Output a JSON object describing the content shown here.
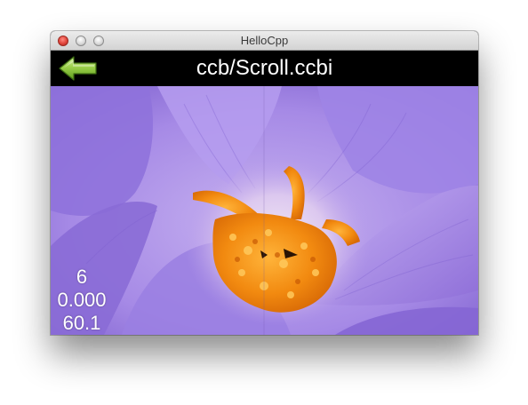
{
  "window": {
    "title": "HelloCpp"
  },
  "header": {
    "title": "ccb/Scroll.ccbi"
  },
  "icons": {
    "back": "back-arrow-icon",
    "close": "close-icon",
    "minimize": "minimize-icon",
    "zoom": "zoom-icon"
  },
  "stats": {
    "draw_calls": "6",
    "seconds_per_frame": "0.000",
    "fps": "60.1"
  },
  "colors": {
    "petal": "#a98be8",
    "petal_dark": "#7f5fd0",
    "stamen": "#f08a12",
    "header_background": "#000000",
    "back_arrow": "#8fc83c"
  }
}
